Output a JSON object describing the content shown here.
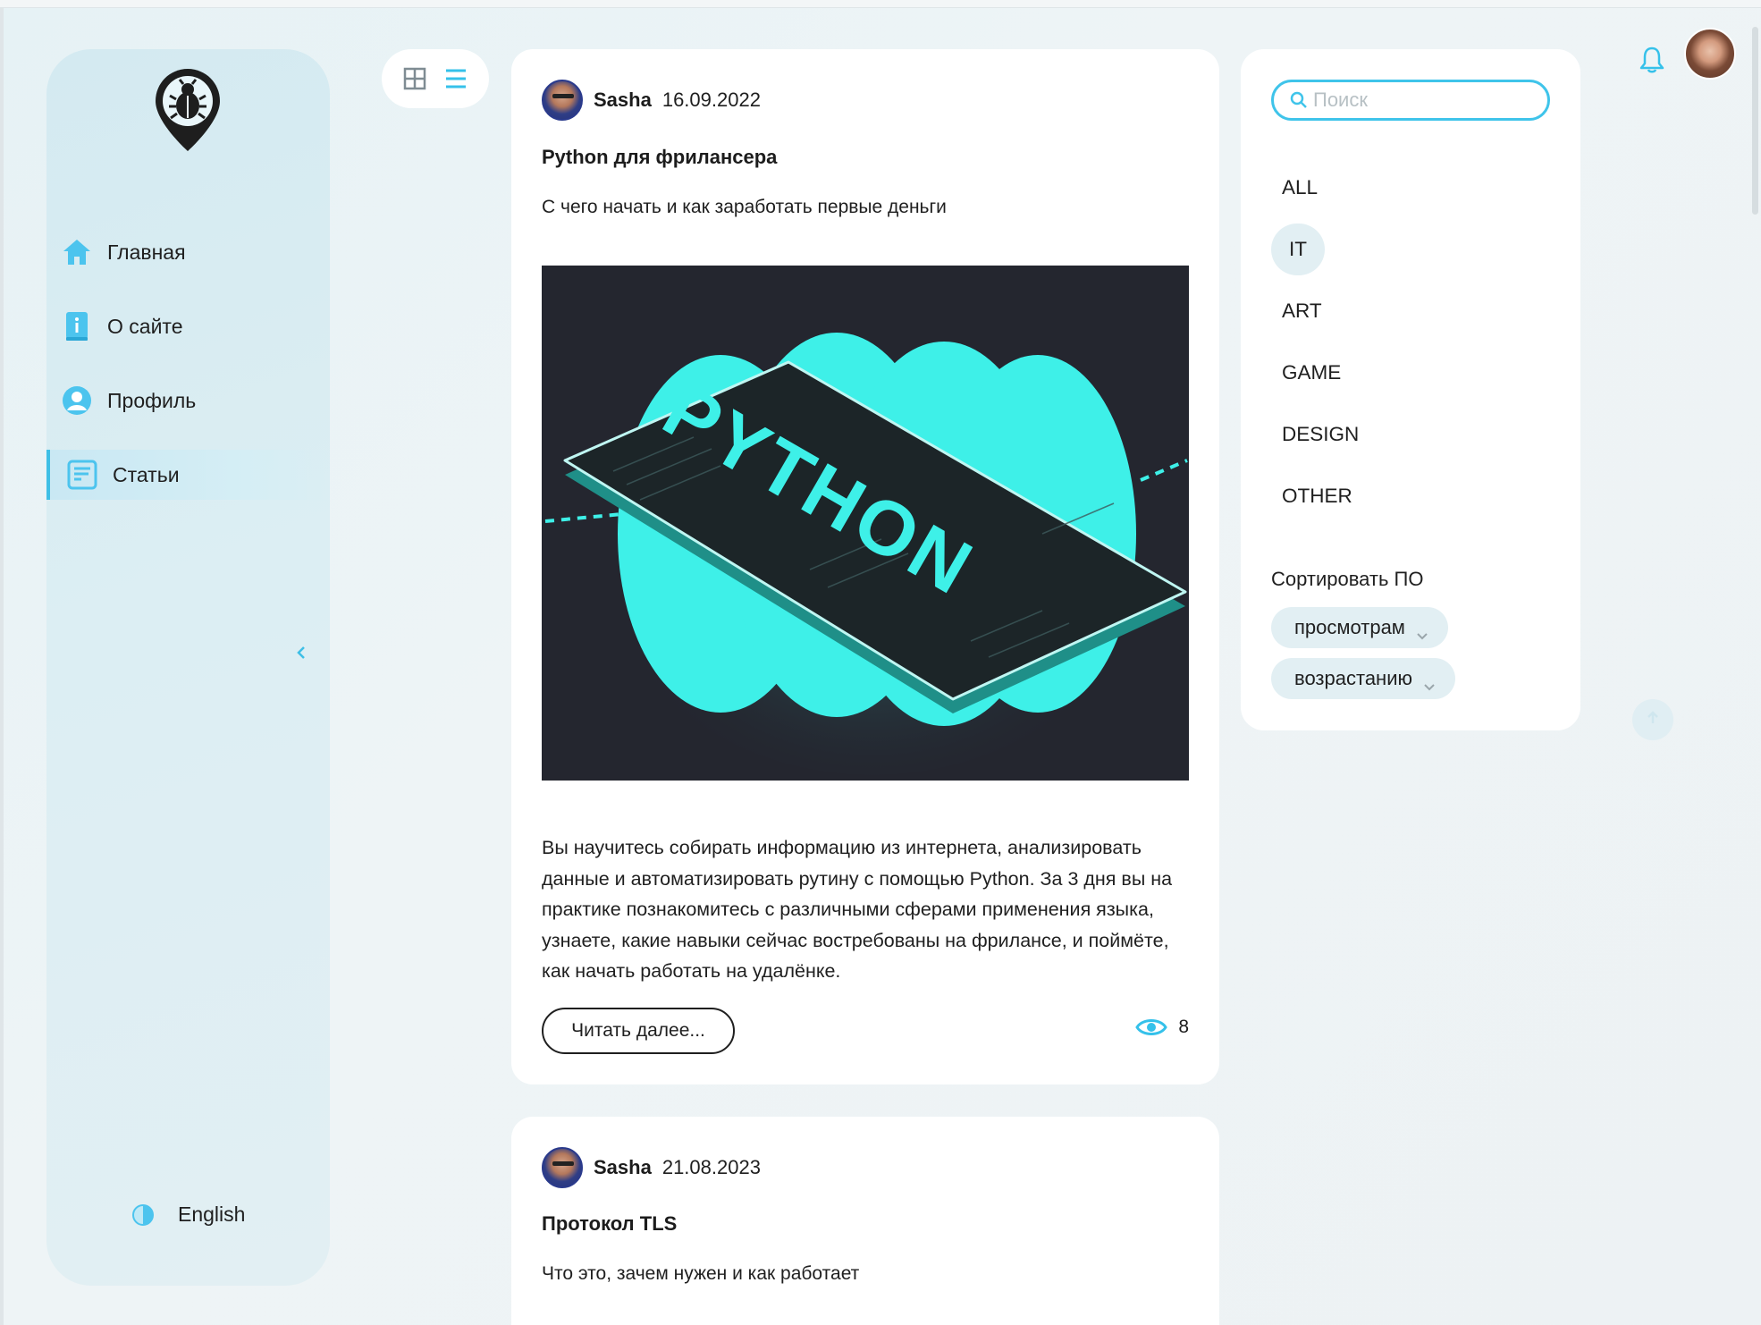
{
  "sidebar": {
    "logo_icon": "bug-pin-icon",
    "items": [
      {
        "label": "Главная",
        "icon": "home-icon",
        "active": false
      },
      {
        "label": "О сайте",
        "icon": "info-book-icon",
        "active": false
      },
      {
        "label": "Профиль",
        "icon": "user-icon",
        "active": false
      },
      {
        "label": "Статьи",
        "icon": "article-icon",
        "active": true
      }
    ],
    "collapse_icon": "chevron-left-icon",
    "language_label": "English",
    "theme_icon": "theme-toggle-icon"
  },
  "view_switch": {
    "grid_icon": "grid-view-icon",
    "list_icon": "list-view-icon",
    "active": "list"
  },
  "articles": [
    {
      "author": "Sasha",
      "date": "16.09.2022",
      "title": "Python для фрилансера",
      "subtitle": "С чего начать и как заработать первые деньги",
      "image_text": "PYTHON",
      "body": "Вы научитесь собирать информацию из интернета, анализировать данные и автоматизировать рутину с помощью Python. За 3 дня вы на практике познакомитесь с различными сферами применения языка, узнаете, какие навыки сейчас востребованы на фрилансе, и поймёте, как начать работать на удалёнке.",
      "read_more": "Читать далее...",
      "views": "8"
    },
    {
      "author": "Sasha",
      "date": "21.08.2023",
      "title": "Протокол TLS",
      "subtitle": "Что это, зачем нужен и как работает"
    }
  ],
  "filters": {
    "search_placeholder": "Поиск",
    "categories": [
      "ALL",
      "IT",
      "ART",
      "GAME",
      "DESIGN",
      "OTHER"
    ],
    "selected_category": "IT",
    "sort_label": "Сортировать ПО",
    "sort_by": "просмотрам",
    "sort_order": "возрастанию"
  },
  "topbar": {
    "notification_icon": "bell-icon",
    "avatar_icon": "user-avatar"
  },
  "colors": {
    "accent": "#3fc4ea",
    "sidebar_bg": "#d8ecf2",
    "card_bg": "#ffffff",
    "image_bg": "#24262f",
    "image_accent": "#3ef0e8"
  }
}
